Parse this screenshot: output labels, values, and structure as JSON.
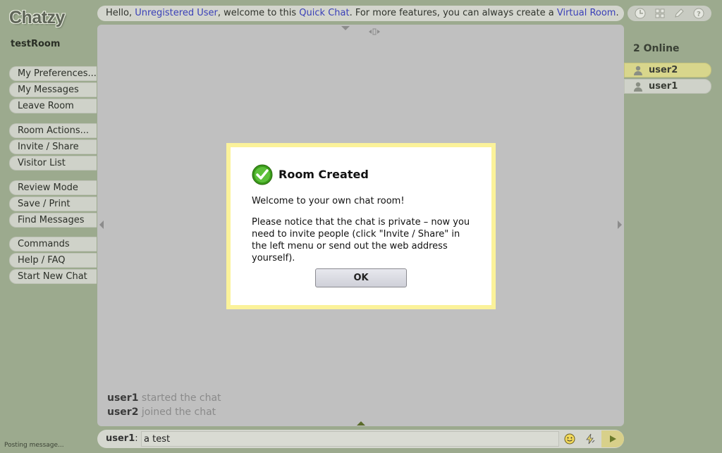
{
  "app": {
    "logo": "Chatzy",
    "room_name": "testRoom"
  },
  "topbar": {
    "t1": "Hello, ",
    "unregistered_link": "Unregistered User",
    "t2": ", welcome to this ",
    "quickchat_link": "Quick Chat",
    "t3": ". For more features, you can always create a ",
    "virtualroom_link": "Virtual Room",
    "t4": "."
  },
  "tools": [
    "clock-icon",
    "grid-icon",
    "pencil-icon",
    "help-icon"
  ],
  "menu": {
    "group1": [
      "My Preferences...",
      "My Messages",
      "Leave Room"
    ],
    "group2": [
      "Room Actions...",
      "Invite / Share",
      "Visitor List"
    ],
    "group3": [
      "Review Mode",
      "Save / Print",
      "Find Messages"
    ],
    "group4": [
      "Commands",
      "Help / FAQ",
      "Start New Chat"
    ]
  },
  "status": {
    "posting": "Posting message..."
  },
  "messages": [
    {
      "user": "user1",
      "text": "started the chat"
    },
    {
      "user": "user2",
      "text": "joined the chat"
    }
  ],
  "input": {
    "user": "user1",
    "sep": ":",
    "value": "a test"
  },
  "online": {
    "count_label": "2 Online",
    "users": [
      "user2",
      "user1"
    ]
  },
  "dialog": {
    "title": "Room Created",
    "p1": "Welcome to your own chat room!",
    "p2": "Please notice that the chat is private – now you need to invite people (click \"Invite / Share\" in the left menu or send out the web address yourself).",
    "ok": "OK"
  },
  "colors": {
    "background": "#9caa8e",
    "link": "#3a40b8",
    "highlight_user": "#d8d68c",
    "dialog_border": "#fbf29a",
    "check": "#3a9a1a"
  }
}
